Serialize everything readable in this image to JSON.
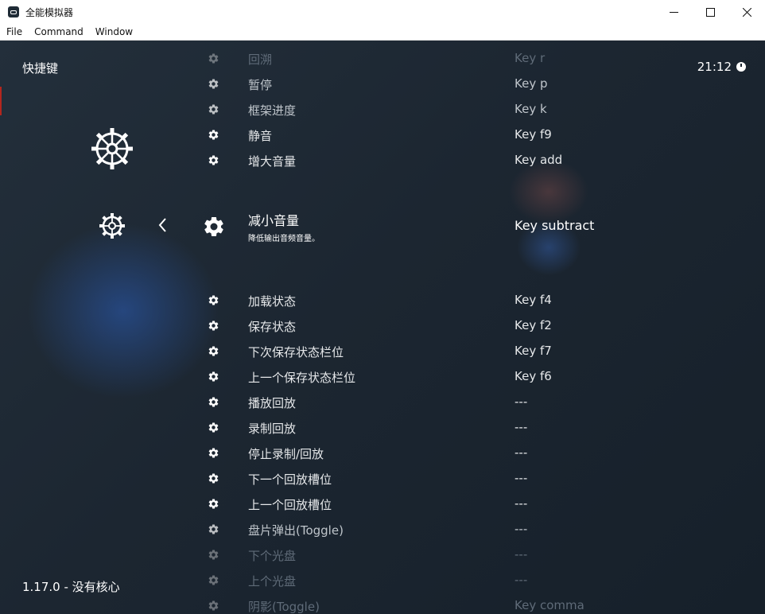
{
  "window": {
    "title": "全能模拟器"
  },
  "menu": [
    {
      "label": "File"
    },
    {
      "label": "Command"
    },
    {
      "label": "Window"
    }
  ],
  "header": {
    "title": "快捷键",
    "clock": "21:12"
  },
  "footer": {
    "version": "1.17.0 - 没有核心"
  },
  "selected": {
    "label": "减小音量",
    "description": "降低输出音频音量。",
    "value": "Key subtract"
  },
  "hotkeys_above": [
    {
      "label": "回溯",
      "value": "Key r"
    },
    {
      "label": "暂停",
      "value": "Key p"
    },
    {
      "label": "框架进度",
      "value": "Key k"
    },
    {
      "label": "静音",
      "value": "Key f9"
    },
    {
      "label": "增大音量",
      "value": "Key add"
    }
  ],
  "hotkeys_below": [
    {
      "label": "加载状态",
      "value": "Key f4"
    },
    {
      "label": "保存状态",
      "value": "Key f2"
    },
    {
      "label": "下次保存状态栏位",
      "value": "Key f7"
    },
    {
      "label": "上一个保存状态栏位",
      "value": "Key f6"
    },
    {
      "label": "播放回放",
      "value": "---"
    },
    {
      "label": "录制回放",
      "value": "---"
    },
    {
      "label": "停止录制/回放",
      "value": "---"
    },
    {
      "label": "下一个回放槽位",
      "value": "---"
    },
    {
      "label": "上一个回放槽位",
      "value": "---"
    },
    {
      "label": "盘片弹出(Toggle)",
      "value": "---"
    },
    {
      "label": "下个光盘",
      "value": "---"
    },
    {
      "label": "上个光盘",
      "value": "---"
    },
    {
      "label": "阴影(Toggle)",
      "value": "Key comma"
    }
  ]
}
